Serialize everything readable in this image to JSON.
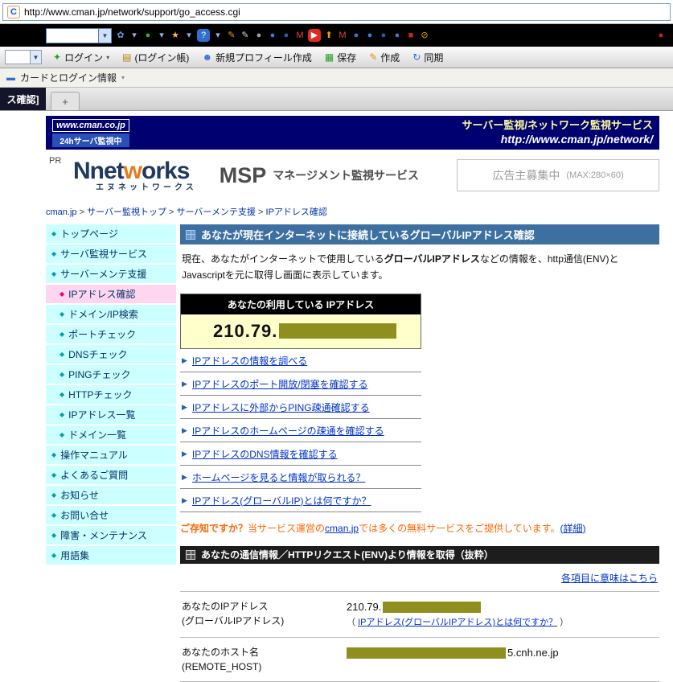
{
  "browser": {
    "glyphs": {
      "dropdown": "▼",
      "chevron": "▾"
    },
    "address": {
      "favicon_letter": "C",
      "url": "http://www.cman.jp/network/support/go_access.cgi"
    },
    "google_toolbar": {
      "icons": [
        {
          "name": "google-pinwheel-icon",
          "glyph": "✿",
          "bg": "none",
          "fg": "#5b9bd5",
          "flat": true
        },
        {
          "name": "dropdown-arrow-icon",
          "glyph": "▾",
          "bg": "none",
          "fg": "#8fb3d9",
          "flat": true
        },
        {
          "name": "green-tool-icon",
          "glyph": "●",
          "bg": "none",
          "fg": "#2db52d",
          "flat": true
        },
        {
          "name": "dropdown-arrow-icon",
          "glyph": "▾",
          "bg": "none",
          "fg": "#8fb3d9",
          "flat": true
        },
        {
          "name": "bookmark-star-icon",
          "glyph": "★",
          "bg": "none",
          "fg": "#f2c230",
          "flat": true
        },
        {
          "name": "dropdown-arrow-icon",
          "glyph": "▾",
          "bg": "none",
          "fg": "#8fb3d9",
          "flat": true
        },
        {
          "name": "info-badge-icon",
          "glyph": "?",
          "bg": "#2f6fd0",
          "fg": "#ffffff"
        },
        {
          "name": "dropdown-arrow-icon",
          "glyph": "▾",
          "bg": "none",
          "fg": "#8fb3d9",
          "flat": true
        },
        {
          "name": "highlighter-icon",
          "glyph": "✎",
          "bg": "none",
          "fg": "#f39c12",
          "flat": true
        },
        {
          "name": "autofill-pencil-icon",
          "glyph": "✎",
          "bg": "none",
          "fg": "#d0d0d0",
          "flat": true
        },
        {
          "name": "gray-orb-icon",
          "glyph": "●",
          "bg": "none",
          "fg": "#a0a0a0",
          "flat": true
        },
        {
          "name": "blue-orb-icon",
          "glyph": "●",
          "bg": "none",
          "fg": "#3d7edb",
          "flat": true
        },
        {
          "name": "blue-orb-icon",
          "glyph": "●",
          "bg": "none",
          "fg": "#2a5db0",
          "flat": true
        },
        {
          "name": "gmail-icon",
          "glyph": "M",
          "bg": "none",
          "fg": "#e8453c",
          "flat": true
        },
        {
          "name": "youtube-icon",
          "glyph": "▶",
          "bg": "#e02b20",
          "fg": "#ffffff"
        },
        {
          "name": "send-up-icon",
          "glyph": "⬆",
          "bg": "none",
          "fg": "#f39c12",
          "flat": true
        },
        {
          "name": "gmail-icon",
          "glyph": "M",
          "bg": "none",
          "fg": "#e8453c",
          "flat": true
        },
        {
          "name": "globe-icon",
          "glyph": "●",
          "bg": "none",
          "fg": "#3a78c9",
          "flat": true
        },
        {
          "name": "blue-orb-icon",
          "glyph": "●",
          "bg": "none",
          "fg": "#3d7edb",
          "flat": true
        },
        {
          "name": "blue-orb-icon",
          "glyph": "●",
          "bg": "none",
          "fg": "#2a5db0",
          "flat": true
        },
        {
          "name": "blue-orb-icon",
          "glyph": "●",
          "bg": "none",
          "fg": "#3d7edb",
          "flat": true
        },
        {
          "name": "red-badge-icon",
          "glyph": "■",
          "bg": "none",
          "fg": "#d02020",
          "flat": true
        },
        {
          "name": "block-icon",
          "glyph": "⊘",
          "bg": "none",
          "fg": "#f39c12",
          "flat": true
        },
        {
          "name": "stop-orb-icon",
          "glyph": "●",
          "bg": "none",
          "fg": "#d42020",
          "flat": true,
          "right": true
        }
      ]
    },
    "roboform": {
      "items": [
        {
          "name": "login-button",
          "icon": "key-icon",
          "glyph": "✦",
          "color": "#2aa02a",
          "label": "ログイン",
          "dropdown": true
        },
        {
          "name": "login-book-button",
          "icon": "book-icon",
          "glyph": "▤",
          "color": "#b8860b",
          "label": "(ログイン帳)",
          "dropdown": false
        },
        {
          "name": "new-profile-button",
          "icon": "person-icon",
          "glyph": "☻",
          "color": "#3a6fd8",
          "label": "新規プロフィール作成",
          "dropdown": false
        },
        {
          "name": "save-button",
          "icon": "save-icon",
          "glyph": "▦",
          "color": "#2aa02a",
          "label": "保存",
          "dropdown": false
        },
        {
          "name": "create-button",
          "icon": "pencil-icon",
          "glyph": "✎",
          "color": "#f08a00",
          "label": "作成",
          "dropdown": false
        },
        {
          "name": "sync-button",
          "icon": "sync-icon",
          "glyph": "↻",
          "color": "#2f6fd0",
          "label": "同期",
          "dropdown": false
        }
      ]
    },
    "cards_bar": {
      "icon_glyph": "▬",
      "label": "カードとログイン情報"
    },
    "tab_bar": {
      "active_label": "ス確認]",
      "new_tab_label": "+"
    }
  },
  "page": {
    "banner": {
      "site": "www.cman.co.jp",
      "badge": "24hサーバ監視中",
      "service_line": "サーバー監視/ネットワーク監視サービス",
      "url_line": "http://www.cman.jp/network/"
    },
    "ad": {
      "pr_label": "PR",
      "brand_pre": "Nnet",
      "brand_accent": "w",
      "brand_post": "orks",
      "brand_kana": "エヌネットワークス",
      "msp": "MSP",
      "msp_desc": "マネージメント監視サービス",
      "slot_main": "広告主募集中",
      "slot_size": "(MAX:280×60)"
    },
    "breadcrumb": {
      "separator": ">",
      "items": [
        "cman.jp",
        "サーバー監視トップ",
        "サーバーメンテ支援",
        "IPアドレス確認"
      ]
    },
    "sidebar": {
      "items": [
        {
          "label": "トップページ"
        },
        {
          "label": "サーバ監視サービス"
        },
        {
          "label": "サーバーメンテ支援"
        },
        {
          "label": "IPアドレス確認",
          "active": true,
          "indent": true
        },
        {
          "label": "ドメイン/IP検索",
          "indent": true
        },
        {
          "label": "ポートチェック",
          "indent": true
        },
        {
          "label": "DNSチェック",
          "indent": true
        },
        {
          "label": "PINGチェック",
          "indent": true
        },
        {
          "label": "HTTPチェック",
          "indent": true
        },
        {
          "label": "IPアドレス一覧",
          "indent": true
        },
        {
          "label": "ドメイン一覧",
          "indent": true
        },
        {
          "label": "操作マニュアル"
        },
        {
          "label": "よくあるご質問"
        },
        {
          "label": "お知らせ"
        },
        {
          "label": "お問い合せ"
        },
        {
          "label": "障害・メンテナンス"
        },
        {
          "label": "用語集"
        }
      ]
    },
    "main": {
      "title": "あなたが現在インターネットに接続しているグローバルIPアドレス確認",
      "intro_pre": "現在、あなたがインターネットで使用している",
      "intro_bold": "グローバルIPアドレス",
      "intro_post": "などの情報を、http通信(ENV)とJavascriptを元に取得し画面に表示しています。",
      "ip_box": {
        "heading": "あなたの利用している IPアドレス",
        "ip_prefix": "210.79."
      },
      "links": [
        "IPアドレスの情報を調べる",
        "IPアドレスのポート開放/閉塞を確認する",
        "IPアドレスに外部からPING疎通確認する",
        "IPアドレスのホームページの疎通を確認する",
        "IPアドレスのDNS情報を確認する",
        "ホームページを見ると情報が取られる？",
        "IPアドレス(グローバルIP)とは何ですか？"
      ],
      "notice": {
        "lead": "ご存知ですか？",
        "pre": "当サービス運営の",
        "link": "cman.jp",
        "post": "では多くの無料サービスをご提供しています。",
        "detail": "(詳細)"
      },
      "env": {
        "heading": "あなたの通信情報／HTTPリクエスト(ENV)より情報を取得（抜粋）",
        "meaning_link": "各項目に意味はこちら",
        "rows": [
          {
            "label": "あなたのIPアドレス",
            "label_sub": "(グローバルIPアドレス)",
            "value_prefix": "210.79.",
            "note_open": "（ ",
            "note_link": "IPアドレス(グローバルIPアドレス)とは何ですか？",
            "note_close": " ）"
          },
          {
            "label": "あなたのホスト名",
            "label_sub": "(REMOTE_HOST)",
            "value_suffix": "5.cnh.ne.jp"
          }
        ]
      }
    }
  }
}
